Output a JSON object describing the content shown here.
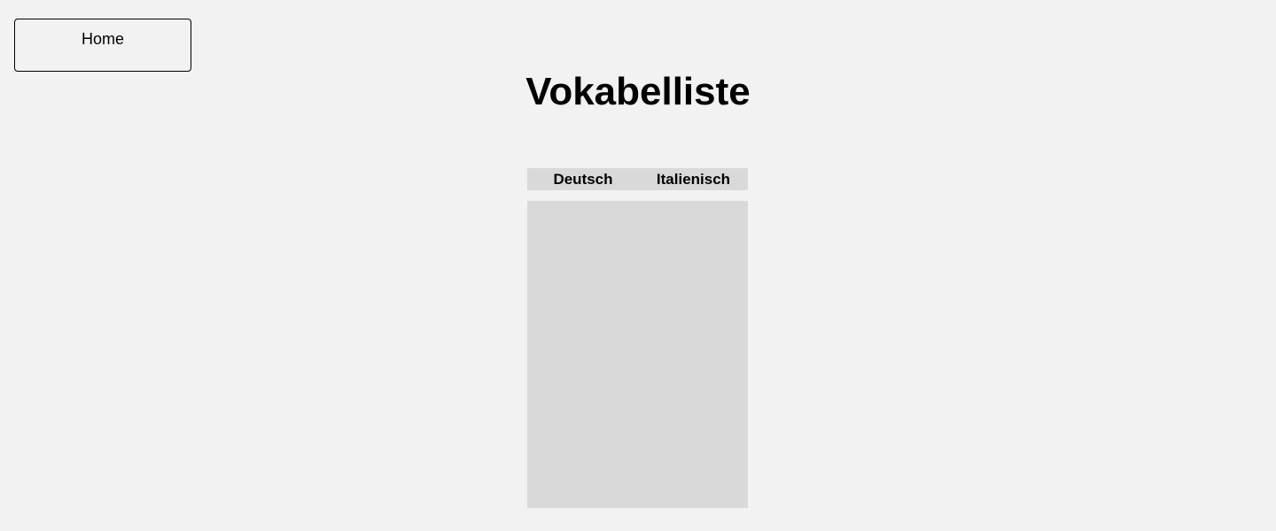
{
  "nav": {
    "home_label": "Home"
  },
  "header": {
    "title": "Vokabelliste"
  },
  "vocab_table": {
    "columns": [
      "Deutsch",
      "Italienisch"
    ],
    "rows": []
  },
  "colors": {
    "background": "#f2f2f2",
    "table_fill": "#d9d9d9",
    "text": "#000000"
  }
}
